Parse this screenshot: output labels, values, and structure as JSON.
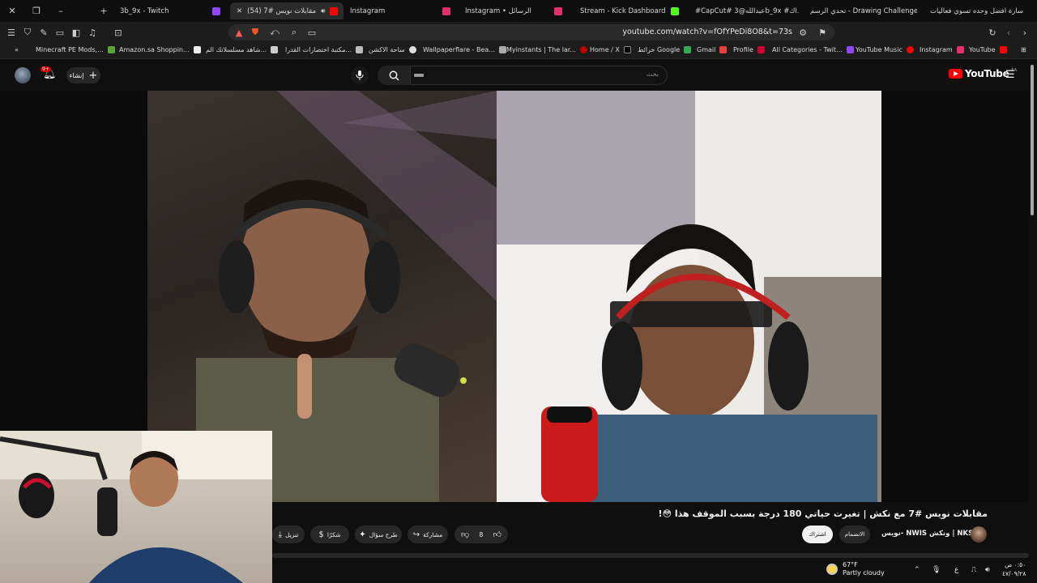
{
  "tabs": [
    {
      "label": "3b_9x - Twitch",
      "active": false
    },
    {
      "label": "(54) مقابلات نويس #7",
      "active": true
    },
    {
      "label": "Instagram",
      "active": false
    },
    {
      "label": "Instagram • الرسائل",
      "active": false
    },
    {
      "label": "Stream - Kick Dashboard",
      "active": false
    },
    {
      "label": "#CapCut# عبدالله@3b_9x #اك...",
      "active": false
    },
    {
      "label": "تحدي الرسم - Drawing Challenge",
      "active": false
    },
    {
      "label": "سارة افضل وحده تسوي فعاليات",
      "active": false
    }
  ],
  "address_bar": {
    "url": "youtube.com/watch?v=fOfYPeDi8O8&t=73s"
  },
  "bookmarks": [
    {
      "label": "Minecraft PE Mods,..."
    },
    {
      "label": "Amazon.sa Shoppin..."
    },
    {
      "label": "شاهد مسلسلاتك الم..."
    },
    {
      "label": "مكتبة اختصارات القدرا..."
    },
    {
      "label": "ساحة الاكشن"
    },
    {
      "label": "Wallpaperflare - Bea..."
    },
    {
      "label": "Myinstants | The lar..."
    },
    {
      "label": "Home / X"
    },
    {
      "label": "خرائط Google"
    },
    {
      "label": "Gmail"
    },
    {
      "label": "Profile"
    },
    {
      "label": "All Categories - Twit..."
    },
    {
      "label": "YouTube Music"
    },
    {
      "label": "Instagram"
    },
    {
      "label": "YouTube"
    }
  ],
  "masthead": {
    "create_label": "إنشاء",
    "notification_count": "9+",
    "search_placeholder": "بحث",
    "logo_text": "YouTube",
    "country_code": "SA"
  },
  "video": {
    "title": "مقابلات نويس #7 مع نكش | تغيرت حياتي 180 درجة بسبب الموقف هذا 😳!",
    "channel": "نويس- NWIS ونكش | NKSH",
    "subscribe_label": "اشتراك",
    "join_label": "الانضمام",
    "like_count": "8",
    "share_label": "مشاركة",
    "ask_label": "طرح سؤال",
    "thanks_label": "شكرًا",
    "download_label": "تنزيل"
  },
  "taskbar": {
    "temperature": "67°F",
    "condition": "Partly cloudy",
    "time": "٠:٥٠ ص",
    "date": "٤٧/٠٩/٢٨",
    "language": "ع"
  }
}
